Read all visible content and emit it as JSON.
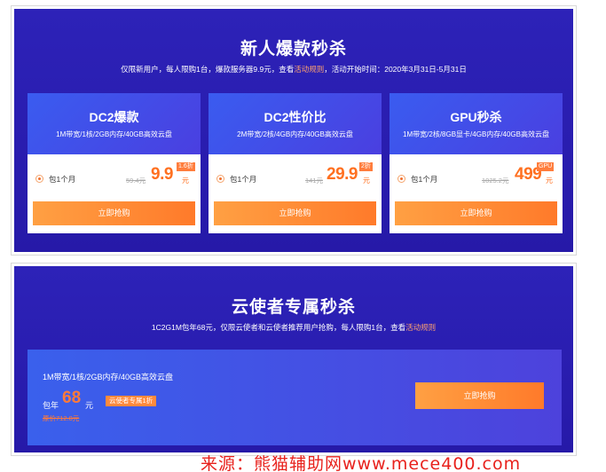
{
  "flash_sale": {
    "title": "新人爆款秒杀",
    "desc_prefix": "仅限新用户，每人限购1台，爆款服务器9.9元，查看",
    "desc_link": "活动规则",
    "desc_suffix": "，活动开始时间：2020年3月31日-5月31日",
    "cards": [
      {
        "name": "DC2爆款",
        "spec": "1M带宽/1核/2GB内存/40GB高效云盘",
        "duration": "包1个月",
        "original": "59.4元",
        "price": "9.9",
        "unit": "元",
        "badge": "1.6折",
        "button": "立即抢购"
      },
      {
        "name": "DC2性价比",
        "spec": "2M带宽/2核/4GB内存/40GB高效云盘",
        "duration": "包1个月",
        "original": "141元",
        "price": "29.9",
        "unit": "元",
        "badge": "2折",
        "button": "立即抢购"
      },
      {
        "name": "GPU秒杀",
        "spec": "1M带宽/2核/8GB显卡/4GB内存/40GB高效云盘",
        "duration": "包1个月",
        "original": "1025.2元",
        "price": "499",
        "unit": "元",
        "badge": "GPU",
        "button": "立即抢购"
      }
    ]
  },
  "envoy_sale": {
    "title": "云使者专属秒杀",
    "desc_prefix": "1C2G1M包年68元，仅限云使者和云使者推荐用户抢购，每人限购1台，查看",
    "desc_link": "活动规则",
    "spec": "1M带宽/1核/2GB内存/40GB高效云盘",
    "price_prefix": "包年",
    "price": "68",
    "unit": "元",
    "badge": "云使者专属1折",
    "original": "原价712.8元",
    "button": "立即抢购"
  },
  "watermark": "来源：熊猫辅助网www.mece400.com",
  "colors": {
    "panel_bg": "#2a1fb0",
    "accent": "#ff7a2a",
    "card_head": "#3a5cf0"
  }
}
